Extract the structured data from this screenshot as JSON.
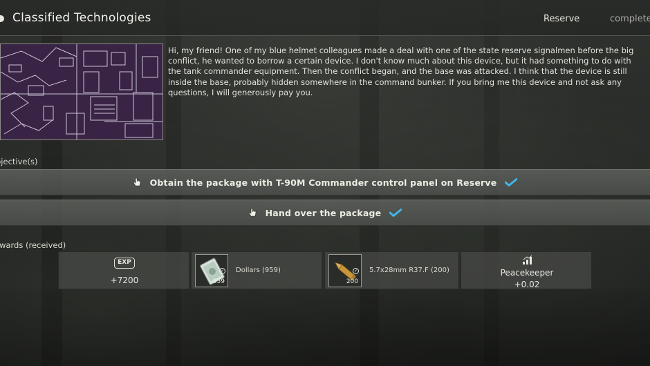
{
  "header": {
    "title": "Classified Technologies",
    "location": "Reserve",
    "status": "complete"
  },
  "description": "Hi, my friend! One of my blue helmet colleagues made a deal with one of the state reserve signalmen before the big conflict, he wanted to borrow a certain device. I don't know much about this device, but it had something to do with the tank commander equipment. Then the conflict began, and the base was attacked. I think that the device is still inside the base, probably hidden somewhere in the command bunker. If you bring me this device and not ask any questions, I will generously pay you.",
  "objectives": {
    "label": "bjective(s)",
    "items": [
      {
        "text": "Obtain the package with T-90M Commander control panel on Reserve",
        "done": true
      },
      {
        "text": "Hand over the package",
        "done": true
      }
    ]
  },
  "rewards": {
    "label": "ewards  (received)",
    "exp": {
      "badge": "EXP",
      "value": "+7200"
    },
    "dollars": {
      "name": "Dollars (959)",
      "count": "959"
    },
    "ammo": {
      "name": "5.7x28mm R37.F (200)",
      "count": "200"
    },
    "reputation": {
      "trader": "Peacekeeper",
      "value": "+0.02"
    }
  },
  "colors": {
    "check": "#3fb6e8",
    "map_bg": "#3a2446",
    "map_lines": "#e6dff0"
  }
}
